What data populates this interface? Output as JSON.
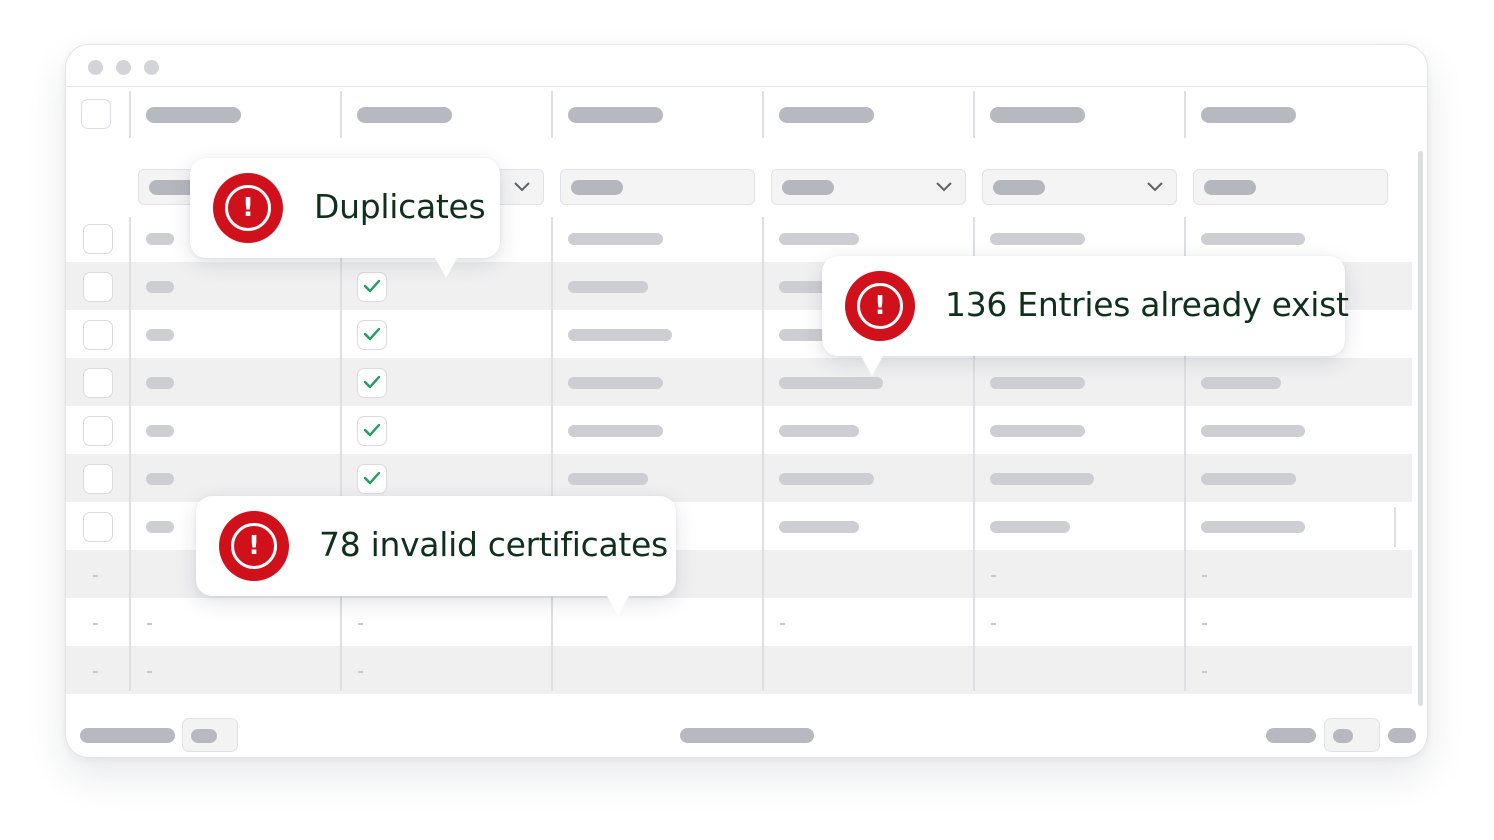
{
  "window": {
    "title_dots": [
      "close",
      "minimize",
      "maximize"
    ]
  },
  "callouts": {
    "duplicates": {
      "text": "Duplicates",
      "icon": "alert-icon"
    },
    "entries_exist": {
      "text": "136 Entries already exist",
      "icon": "alert-icon"
    },
    "invalid_certs": {
      "text": "78 invalid certificates",
      "icon": "alert-icon"
    }
  },
  "colors": {
    "alert_red": "#d0111b",
    "check_green": "#1e9e5e",
    "text_dark_green": "#10301c",
    "placeholder_gray": "#b7b9c0"
  }
}
